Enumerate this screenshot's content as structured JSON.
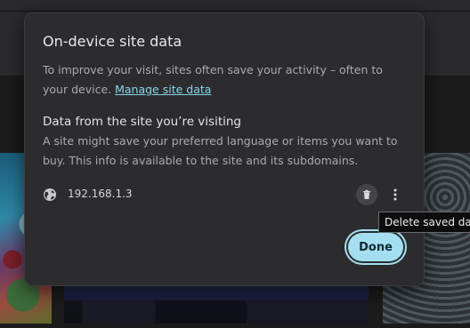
{
  "dialog": {
    "title": "On-device site data",
    "intro_text": "To improve your visit, sites often save your activity – often to your device. ",
    "manage_link": "Manage site data",
    "section_heading": "Data from the site you’re visiting",
    "section_text": "A site might save your preferred language or items you want to buy. This info is available to the site and its subdomains.",
    "site": {
      "icon": "globe-icon",
      "name": "192.168.1.3",
      "delete_icon": "trash-icon",
      "more_icon": "more-vert-icon"
    },
    "done_label": "Done"
  },
  "tooltip": {
    "text": "Delete saved data"
  },
  "colors": {
    "dialog_bg": "#2c2c2f",
    "link": "#8ad5e8",
    "done_bg": "#a3dff0"
  }
}
